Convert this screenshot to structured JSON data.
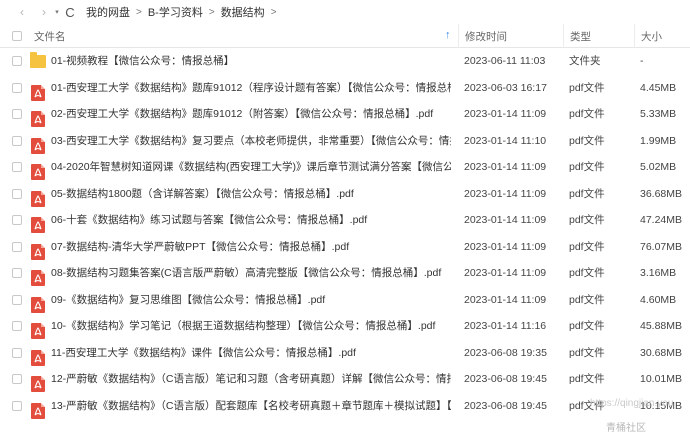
{
  "nav": {
    "back": "‹",
    "forward": "›",
    "dropdown": "▾",
    "refresh": "C",
    "breadcrumbs": [
      "我的网盘",
      "B-学习资料",
      "数据结构"
    ],
    "separator": ">"
  },
  "header": {
    "name": "文件名",
    "sort_arrow": "↑",
    "date": "修改时间",
    "type": "类型",
    "size": "大小"
  },
  "files": [
    {
      "name": "01-视频教程【微信公众号：情报总桶】",
      "date": "2023-06-11 11:03",
      "type": "文件夹",
      "size": "-",
      "icon": "folder-icon"
    },
    {
      "name": "01-西安理工大学《数据结构》题库91012（程序设计题有答案）【微信公众号：情报总桶】.pdf",
      "date": "2023-06-03 16:17",
      "type": "pdf文件",
      "size": "4.45MB",
      "icon": "pdf-icon"
    },
    {
      "name": "02-西安理工大学《数据结构》题库91012（附答案）【微信公众号：情报总桶】.pdf",
      "date": "2023-01-14 11:09",
      "type": "pdf文件",
      "size": "5.33MB",
      "icon": "pdf-icon"
    },
    {
      "name": "03-西安理工大学《数据结构》复习要点（本校老师提供，非常重要）【微信公众号：情报总桶】.pdf",
      "date": "2023-01-14 11:10",
      "type": "pdf文件",
      "size": "1.99MB",
      "icon": "pdf-icon"
    },
    {
      "name": "04-2020年智慧树知道网课《数据结构(西安理工大学)》课后章节测试满分答案【微信公众号：情报总桶】.pdf",
      "date": "2023-01-14 11:09",
      "type": "pdf文件",
      "size": "5.02MB",
      "icon": "pdf-icon"
    },
    {
      "name": "05-数据结构1800题（含详解答案）【微信公众号：情报总桶】.pdf",
      "date": "2023-01-14 11:09",
      "type": "pdf文件",
      "size": "36.68MB",
      "icon": "pdf-icon"
    },
    {
      "name": "06-十套《数据结构》练习试题与答案【微信公众号：情报总桶】.pdf",
      "date": "2023-01-14 11:09",
      "type": "pdf文件",
      "size": "47.24MB",
      "icon": "pdf-icon"
    },
    {
      "name": "07-数据结构-清华大学严蔚敏PPT【微信公众号：情报总桶】.pdf",
      "date": "2023-01-14 11:09",
      "type": "pdf文件",
      "size": "76.07MB",
      "icon": "pdf-icon"
    },
    {
      "name": "08-数据结构习题集答案(C语言版严蔚敏）高清完整版【微信公众号：情报总桶】.pdf",
      "date": "2023-01-14 11:09",
      "type": "pdf文件",
      "size": "3.16MB",
      "icon": "pdf-icon"
    },
    {
      "name": "09-《数据结构》复习思维图【微信公众号：情报总桶】.pdf",
      "date": "2023-01-14 11:09",
      "type": "pdf文件",
      "size": "4.60MB",
      "icon": "pdf-icon"
    },
    {
      "name": "10-《数据结构》学习笔记（根据王道数据结构整理）【微信公众号：情报总桶】.pdf",
      "date": "2023-01-14 11:16",
      "type": "pdf文件",
      "size": "45.88MB",
      "icon": "pdf-icon"
    },
    {
      "name": "11-西安理工大学《数据结构》课件【微信公众号：情报总桶】.pdf",
      "date": "2023-06-08 19:35",
      "type": "pdf文件",
      "size": "30.68MB",
      "icon": "pdf-icon"
    },
    {
      "name": "12-严蔚敏《数据结构》（C语言版）笔记和习题（含考研真题）详解【微信公众号：情报总桶】.pdf",
      "date": "2023-06-08 19:45",
      "type": "pdf文件",
      "size": "10.01MB",
      "icon": "pdf-icon"
    },
    {
      "name": "13-严蔚敏《数据结构》（C语言版）配套题库【名校考研真题＋章节题库＋模拟试题】【微信公众号：情报总桶】.pdf",
      "date": "2023-06-08 19:45",
      "type": "pdf文件",
      "size": "10.15MB",
      "icon": "pdf-icon"
    }
  ],
  "watermark": {
    "line1": "https://qingjian.you",
    "line2": "青桶社区"
  },
  "colors": {
    "pdf": "#e34d3d",
    "folder": "#f6c341",
    "accent": "#3a8ee6"
  }
}
